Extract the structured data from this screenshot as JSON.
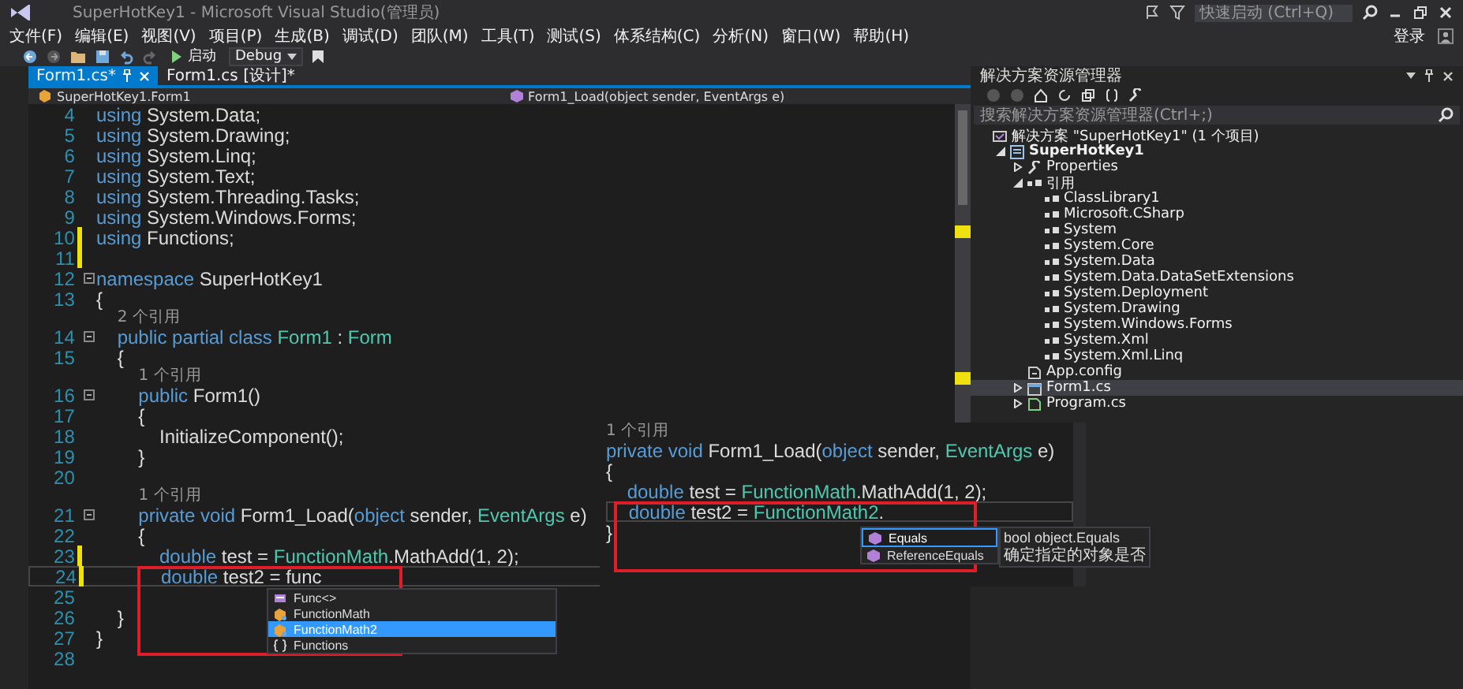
{
  "window": {
    "title": "SuperHotKey1 - Microsoft Visual Studio(管理员)",
    "quick_launch": {
      "placeholder": "快速启动 (Ctrl+Q)"
    }
  },
  "menu": [
    "文件(F)",
    "编辑(E)",
    "视图(V)",
    "项目(P)",
    "生成(B)",
    "调试(D)",
    "团队(M)",
    "工具(T)",
    "测试(S)",
    "体系结构(C)",
    "分析(N)",
    "窗口(W)",
    "帮助(H)"
  ],
  "account": "登录",
  "toolbar": {
    "start": "启动",
    "configuration": "Debug"
  },
  "tabs": [
    {
      "label": "Form1.cs*",
      "selected": true
    },
    {
      "label": "Form1.cs [设计]*",
      "selected": false
    }
  ],
  "navigation": {
    "type": "SuperHotKey1.Form1",
    "member": "Form1_Load(object sender, EventArgs e)"
  },
  "editor": {
    "lines": [
      {
        "number": "4",
        "changed": false,
        "foldable": false,
        "current": false,
        "tokens": [
          {
            "kind": "keyword",
            "text": "using"
          },
          {
            "kind": "plain",
            "text": " System.Data;"
          }
        ]
      },
      {
        "number": "5",
        "changed": false,
        "foldable": false,
        "current": false,
        "tokens": [
          {
            "kind": "keyword",
            "text": "using"
          },
          {
            "kind": "plain",
            "text": " System.Drawing;"
          }
        ]
      },
      {
        "number": "6",
        "changed": false,
        "foldable": false,
        "current": false,
        "tokens": [
          {
            "kind": "keyword",
            "text": "using"
          },
          {
            "kind": "plain",
            "text": " System.Linq;"
          }
        ]
      },
      {
        "number": "7",
        "changed": false,
        "foldable": false,
        "current": false,
        "tokens": [
          {
            "kind": "keyword",
            "text": "using"
          },
          {
            "kind": "plain",
            "text": " System.Text;"
          }
        ]
      },
      {
        "number": "8",
        "changed": false,
        "foldable": false,
        "current": false,
        "tokens": [
          {
            "kind": "keyword",
            "text": "using"
          },
          {
            "kind": "plain",
            "text": " System.Threading.Tasks;"
          }
        ]
      },
      {
        "number": "9",
        "changed": false,
        "foldable": false,
        "current": false,
        "tokens": [
          {
            "kind": "keyword",
            "text": "using"
          },
          {
            "kind": "plain",
            "text": " System.Windows.Forms;"
          }
        ]
      },
      {
        "number": "10",
        "changed": true,
        "foldable": false,
        "current": false,
        "tokens": [
          {
            "kind": "keyword",
            "text": "using"
          },
          {
            "kind": "plain",
            "text": " Functions;"
          }
        ]
      },
      {
        "number": "11",
        "changed": true,
        "foldable": false,
        "current": false
      },
      {
        "number": "12",
        "changed": false,
        "foldable": true,
        "current": false,
        "tokens": [
          {
            "kind": "keyword",
            "text": "namespace"
          },
          {
            "kind": "plain",
            "text": " SuperHotKey1"
          }
        ]
      },
      {
        "number": "13",
        "changed": false,
        "foldable": false,
        "current": false,
        "tokens": [
          {
            "kind": "plain",
            "text": "{"
          }
        ]
      },
      {
        "number": "14",
        "changed": false,
        "foldable": true,
        "current": false,
        "codelens": "2 个引用",
        "tokens": [
          {
            "kind": "keyword",
            "text": "    public partial class"
          },
          {
            "kind": "type",
            "text": " Form1"
          },
          {
            "kind": "plain",
            "text": " : "
          },
          {
            "kind": "type",
            "text": "Form"
          }
        ]
      },
      {
        "number": "15",
        "changed": false,
        "foldable": false,
        "current": false,
        "tokens": [
          {
            "kind": "plain",
            "text": "    {"
          }
        ]
      },
      {
        "number": "16",
        "changed": false,
        "foldable": true,
        "current": false,
        "codelens": "1 个引用",
        "tokens": [
          {
            "kind": "keyword",
            "text": "        public"
          },
          {
            "kind": "plain",
            "text": " Form1()"
          }
        ]
      },
      {
        "number": "17",
        "changed": false,
        "foldable": false,
        "current": false,
        "tokens": [
          {
            "kind": "plain",
            "text": "        {"
          }
        ]
      },
      {
        "number": "18",
        "changed": false,
        "foldable": false,
        "current": false,
        "tokens": [
          {
            "kind": "plain",
            "text": "            InitializeComponent();"
          }
        ]
      },
      {
        "number": "19",
        "changed": false,
        "foldable": false,
        "current": false,
        "tokens": [
          {
            "kind": "plain",
            "text": "        }"
          }
        ]
      },
      {
        "number": "20",
        "changed": false,
        "foldable": false,
        "current": false
      },
      {
        "number": "21",
        "changed": false,
        "foldable": true,
        "current": false,
        "codelens": "1 个引用",
        "tokens": [
          {
            "kind": "keyword",
            "text": "        private void"
          },
          {
            "kind": "plain",
            "text": " Form1_Load("
          },
          {
            "kind": "keyword",
            "text": "object"
          },
          {
            "kind": "plain",
            "text": " sender, "
          },
          {
            "kind": "type",
            "text": "EventArgs"
          },
          {
            "kind": "plain",
            "text": " e)"
          }
        ]
      },
      {
        "number": "22",
        "changed": false,
        "foldable": false,
        "current": false,
        "tokens": [
          {
            "kind": "plain",
            "text": "        {"
          }
        ]
      },
      {
        "number": "23",
        "changed": true,
        "foldable": false,
        "current": false,
        "tokens": [
          {
            "kind": "keyword",
            "text": "            double"
          },
          {
            "kind": "plain",
            "text": " test = "
          },
          {
            "kind": "type",
            "text": "FunctionMath"
          },
          {
            "kind": "plain",
            "text": ".MathAdd(1, 2);"
          }
        ]
      },
      {
        "number": "24",
        "changed": true,
        "foldable": false,
        "current": true,
        "tokens": [
          {
            "kind": "keyword",
            "text": "            double"
          },
          {
            "kind": "plain",
            "text": " test2 = func"
          }
        ]
      },
      {
        "number": "25",
        "changed": false,
        "foldable": false,
        "current": false
      },
      {
        "number": "26",
        "changed": false,
        "foldable": false,
        "current": false,
        "tokens": [
          {
            "kind": "plain",
            "text": "    }"
          }
        ]
      },
      {
        "number": "27",
        "changed": false,
        "foldable": false,
        "current": false,
        "tokens": [
          {
            "kind": "plain",
            "text": "}"
          }
        ]
      },
      {
        "number": "28",
        "changed": false,
        "foldable": false,
        "current": false
      }
    ],
    "completion": {
      "items": [
        {
          "kind": "delegate",
          "label": "Func<>",
          "selected": false
        },
        {
          "kind": "class",
          "label": "FunctionMath",
          "selected": false
        },
        {
          "kind": "class",
          "label": "FunctionMath2",
          "selected": true
        },
        {
          "kind": "namespace",
          "label": "Functions",
          "selected": false
        }
      ]
    }
  },
  "inset": {
    "lines": [
      {
        "current": false,
        "codelens": "1 个引用",
        "tokens": [
          {
            "kind": "keyword",
            "text": "private void"
          },
          {
            "kind": "plain",
            "text": " Form1_Load("
          },
          {
            "kind": "keyword",
            "text": "object"
          },
          {
            "kind": "plain",
            "text": " sender, "
          },
          {
            "kind": "type",
            "text": "EventArgs"
          },
          {
            "kind": "plain",
            "text": " e)"
          }
        ]
      },
      {
        "current": false,
        "tokens": [
          {
            "kind": "plain",
            "text": "{"
          }
        ]
      },
      {
        "current": false,
        "tokens": [
          {
            "kind": "keyword",
            "text": "    double"
          },
          {
            "kind": "plain",
            "text": " test = "
          },
          {
            "kind": "type",
            "text": "FunctionMath"
          },
          {
            "kind": "plain",
            "text": ".MathAdd(1, 2);"
          }
        ]
      },
      {
        "current": true,
        "tokens": [
          {
            "kind": "keyword",
            "text": "    double"
          },
          {
            "kind": "plain",
            "text": " test2 = "
          },
          {
            "kind": "type",
            "text": "FunctionMath2"
          },
          {
            "kind": "plain",
            "text": "."
          }
        ]
      },
      {
        "current": false,
        "tokens": [
          {
            "kind": "plain",
            "text": "}"
          }
        ]
      }
    ],
    "completion": {
      "items": [
        {
          "kind": "method",
          "label": "Equals",
          "selected": true
        },
        {
          "kind": "method",
          "label": "ReferenceEquals",
          "selected": false
        }
      ]
    },
    "tooltip": {
      "signature": "bool object.Equals",
      "description": "确定指定的对象是否"
    }
  },
  "solution_explorer": {
    "title": "解决方案资源管理器",
    "search": {
      "placeholder": "搜索解决方案资源管理器(Ctrl+;)"
    },
    "tree": [
      {
        "kind": "solution",
        "label": "解决方案 \"SuperHotKey1\" (1 个项目)",
        "selected": false,
        "children": [
          {
            "kind": "project",
            "label": "SuperHotKey1",
            "expanded": true,
            "selected": false,
            "children": [
              {
                "kind": "properties",
                "label": "Properties",
                "expanded": false,
                "selected": false
              },
              {
                "kind": "references",
                "label": "引用",
                "expanded": true,
                "selected": false,
                "children": [
                  {
                    "kind": "reference",
                    "label": "ClassLibrary1",
                    "selected": false
                  },
                  {
                    "kind": "reference",
                    "label": "Microsoft.CSharp",
                    "selected": false
                  },
                  {
                    "kind": "reference",
                    "label": "System",
                    "selected": false
                  },
                  {
                    "kind": "reference",
                    "label": "System.Core",
                    "selected": false
                  },
                  {
                    "kind": "reference",
                    "label": "System.Data",
                    "selected": false
                  },
                  {
                    "kind": "reference",
                    "label": "System.Data.DataSetExtensions",
                    "selected": false
                  },
                  {
                    "kind": "reference",
                    "label": "System.Deployment",
                    "selected": false
                  },
                  {
                    "kind": "reference",
                    "label": "System.Drawing",
                    "selected": false
                  },
                  {
                    "kind": "reference",
                    "label": "System.Windows.Forms",
                    "selected": false
                  },
                  {
                    "kind": "reference",
                    "label": "System.Xml",
                    "selected": false
                  },
                  {
                    "kind": "reference",
                    "label": "System.Xml.Linq",
                    "selected": false
                  }
                ]
              },
              {
                "kind": "config",
                "label": "App.config",
                "selected": false
              },
              {
                "kind": "form",
                "label": "Form1.cs",
                "expanded": false,
                "selected": true
              },
              {
                "kind": "code",
                "label": "Program.cs",
                "expanded": false,
                "selected": false
              }
            ]
          }
        ]
      }
    ]
  }
}
